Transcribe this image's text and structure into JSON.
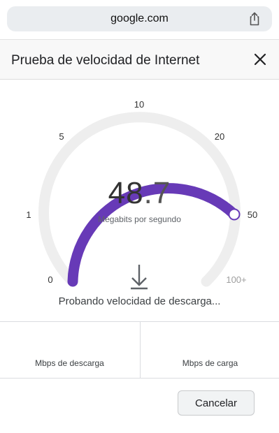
{
  "browser": {
    "url": "google.com",
    "share_icon": "share-icon"
  },
  "dialog": {
    "title": "Prueba de velocidad de Internet",
    "close_icon": "close-icon"
  },
  "gauge": {
    "ticks": [
      "0",
      "1",
      "5",
      "10",
      "20",
      "50",
      "100+"
    ],
    "value_int": "48",
    "value_dec": ".7",
    "unit": "Megabits por segundo",
    "accent_color": "#673ab7",
    "track_color": "#eeeeee"
  },
  "status": {
    "text": "Probando velocidad de descarga..."
  },
  "results": {
    "download_label": "Mbps de descarga",
    "upload_label": "Mbps de carga"
  },
  "actions": {
    "cancel_label": "Cancelar"
  }
}
